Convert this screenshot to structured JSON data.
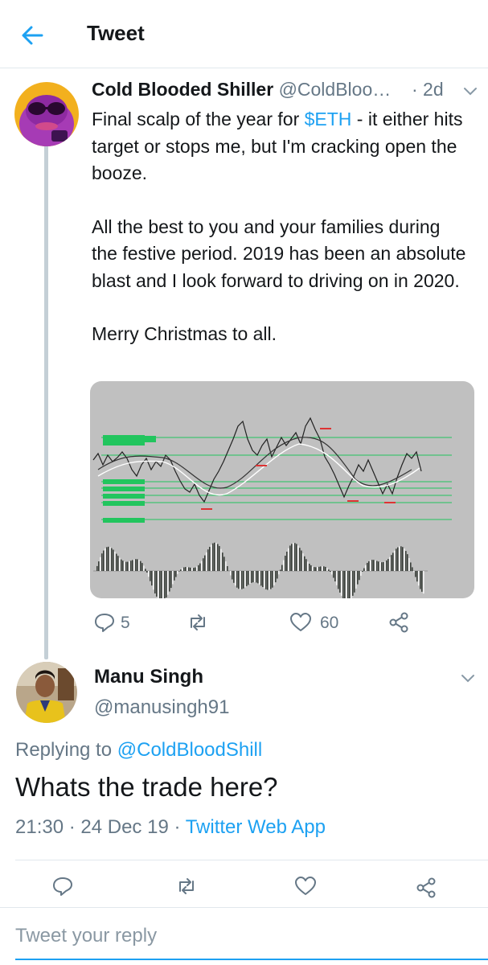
{
  "header": {
    "title": "Tweet"
  },
  "tweet": {
    "display_name": "Cold Blooded Shiller",
    "handle": "@ColdBloo…",
    "time": "· 2d",
    "text_before": "Final scalp of the year for ",
    "cashtag": "$ETH",
    "text_after": " - it either hits target or stops me, but I'm cracking open the booze.",
    "paragraph2": "All the best to you and your families during the festive period. 2019 has been an absolute blast and I look forward to driving on in 2020.",
    "paragraph3": "Merry Christmas to all.",
    "actions": {
      "replies": "5",
      "retweets": "",
      "likes": "60"
    }
  },
  "reply": {
    "display_name": "Manu Singh",
    "handle": "@manusingh91",
    "replying_label": "Replying to ",
    "replying_handle": "@ColdBloodShill",
    "text": "Whats the trade here?",
    "timestamp": "21:30 · 24 Dec 19 · ",
    "source": "Twitter Web App"
  },
  "composer": {
    "placeholder": "Tweet your reply"
  },
  "colors": {
    "accent": "#1da1f2",
    "muted": "#657786",
    "chart_bg": "#c0c0c0",
    "level_line": "#22c55e"
  },
  "icons": {
    "back": "arrow-left-icon",
    "more": "chevron-down-icon",
    "reply": "reply-icon",
    "retweet": "retweet-icon",
    "like": "heart-icon",
    "share": "share-icon"
  }
}
